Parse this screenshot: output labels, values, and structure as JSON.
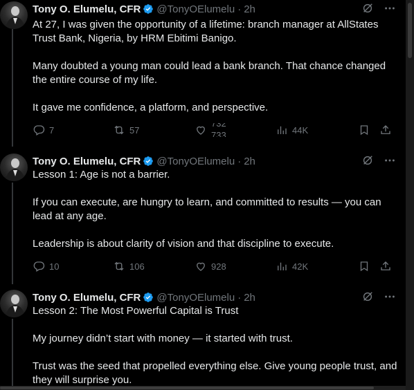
{
  "tweets": [
    {
      "name": "Tony O. Elumelu, CFR",
      "handle": "@TonyOElumelu",
      "time": "2h",
      "paragraphs": [
        "At 27, I was given the opportunity of a lifetime: branch manager at AllStates Trust Bank, Nigeria, by HRM Ebitimi Banigo.",
        "Many doubted a young man could lead a bank branch. That chance changed the entire course of my life.",
        "It gave me confidence, a platform, and perspective."
      ],
      "replies": "7",
      "reposts": "57",
      "likes_old": "732",
      "likes": "733",
      "views": "44K"
    },
    {
      "name": "Tony O. Elumelu, CFR",
      "handle": "@TonyOElumelu",
      "time": "2h",
      "paragraphs": [
        "Lesson 1: Age is not a barrier.",
        "If you can execute, are hungry to learn, and committed to results — you can lead at any age.",
        "Leadership is about clarity of vision and that discipline to execute."
      ],
      "replies": "10",
      "reposts": "106",
      "likes": "928",
      "views": "42K"
    },
    {
      "name": "Tony O. Elumelu, CFR",
      "handle": "@TonyOElumelu",
      "time": "2h",
      "paragraphs": [
        "Lesson 2: The Most Powerful Capital is Trust",
        "My journey didn’t start with money — it  started with trust.",
        "Trust was the seed that propelled everything else. Give young people trust, and they will surprise you."
      ]
    }
  ],
  "colors": {
    "verified": "#1d9bf0",
    "muted": "#71767b",
    "text": "#e7e9ea",
    "bg": "#000000"
  }
}
